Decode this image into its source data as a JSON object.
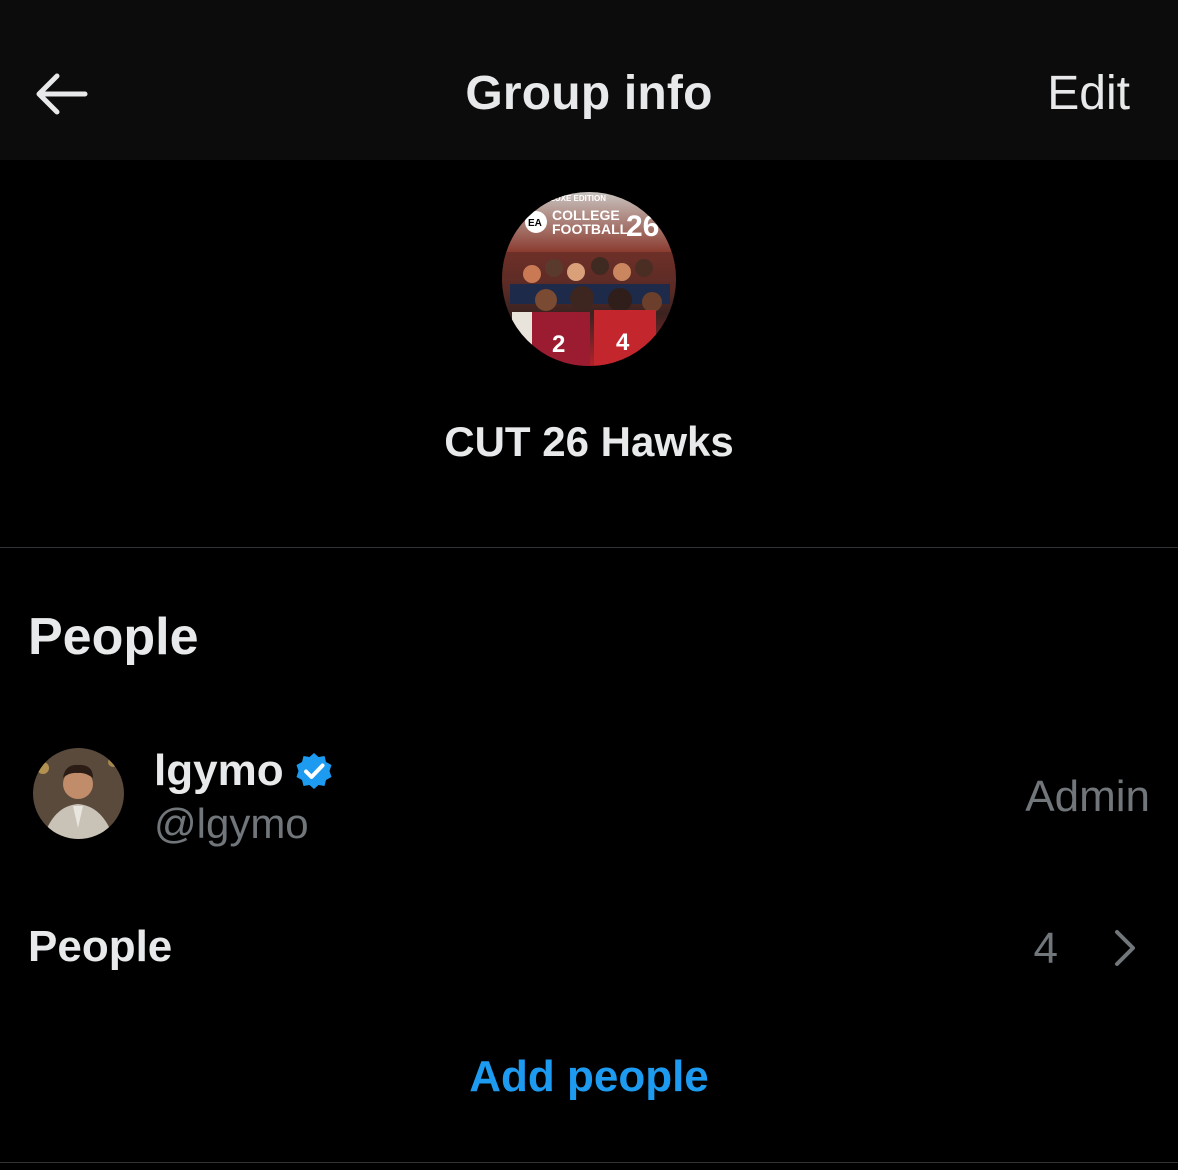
{
  "header": {
    "title": "Group info",
    "edit_label": "Edit"
  },
  "group": {
    "name": "CUT 26 Hawks",
    "avatar_text_top": "LUXE EDITION",
    "avatar_text_main": "COLLEGE FOOTBALL",
    "avatar_text_number": "26",
    "avatar_text_brand": "EA"
  },
  "people_section": {
    "title": "People",
    "members": [
      {
        "name": "lgymo",
        "handle": "@lgymo",
        "role": "Admin",
        "verified": true
      }
    ],
    "people_row_label": "People",
    "people_count": "4",
    "add_people_label": "Add people"
  },
  "colors": {
    "background": "#000000",
    "header_bg": "#0c0c0c",
    "primary_text": "#e7e9ea",
    "secondary_text": "#71767b",
    "accent": "#1d9bf0",
    "divider": "#2f3336"
  }
}
